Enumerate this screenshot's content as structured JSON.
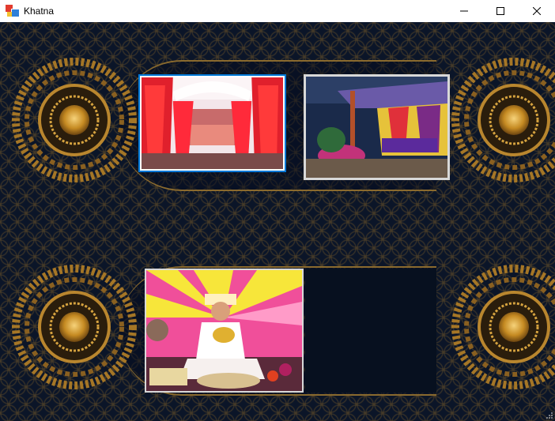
{
  "window": {
    "title": "Khatna"
  },
  "icons": {
    "app": "app-icon",
    "minimize": "minimize-icon",
    "maximize": "maximize-icon",
    "close": "close-icon",
    "grip": "resize-grip-icon"
  },
  "colors": {
    "background": "#0b1528",
    "gold": "#c9962f",
    "selection": "#0078d7",
    "frame": "#d8d8d8"
  },
  "gallery": [
    {
      "photo": "stage-red-curtains"
    },
    {
      "photo": "outdoor-tent-decor"
    },
    {
      "photo": "child-on-stage"
    }
  ]
}
